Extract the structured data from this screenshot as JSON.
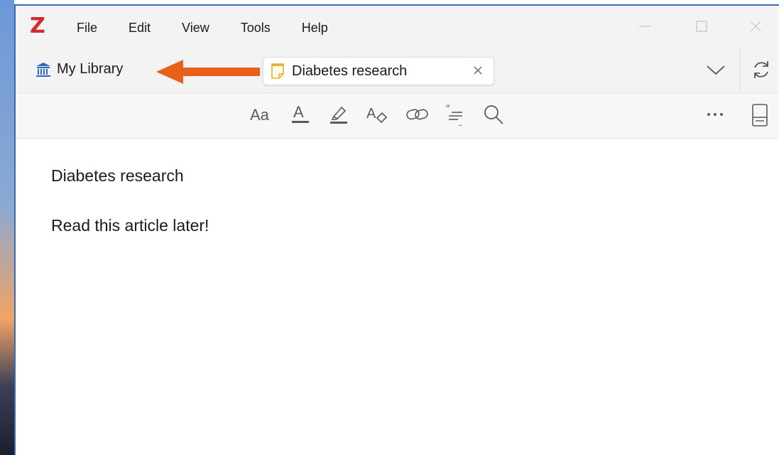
{
  "app": {
    "logo_letter": "Z",
    "logo_color": "#d22b2b"
  },
  "menu": {
    "items": [
      "File",
      "Edit",
      "View",
      "Tools",
      "Help"
    ]
  },
  "window_controls": [
    "minimize-icon",
    "maximize-icon",
    "close-icon"
  ],
  "tabs": {
    "library": {
      "label": "My Library",
      "icon": "library-icon"
    },
    "note": {
      "label": "Diabetes research",
      "icon": "note-icon"
    }
  },
  "annotation": {
    "arrow_color": "#e8601c",
    "icon": "arrow-left-icon"
  },
  "toolbar": {
    "tools": [
      "text-format-icon",
      "text-color-icon",
      "highlight-icon",
      "clear-formatting-icon",
      "link-icon",
      "citation-icon",
      "find-icon"
    ],
    "more_label": "•••"
  },
  "note": {
    "paragraphs": [
      "Diabetes research",
      "Read this article later!"
    ]
  }
}
